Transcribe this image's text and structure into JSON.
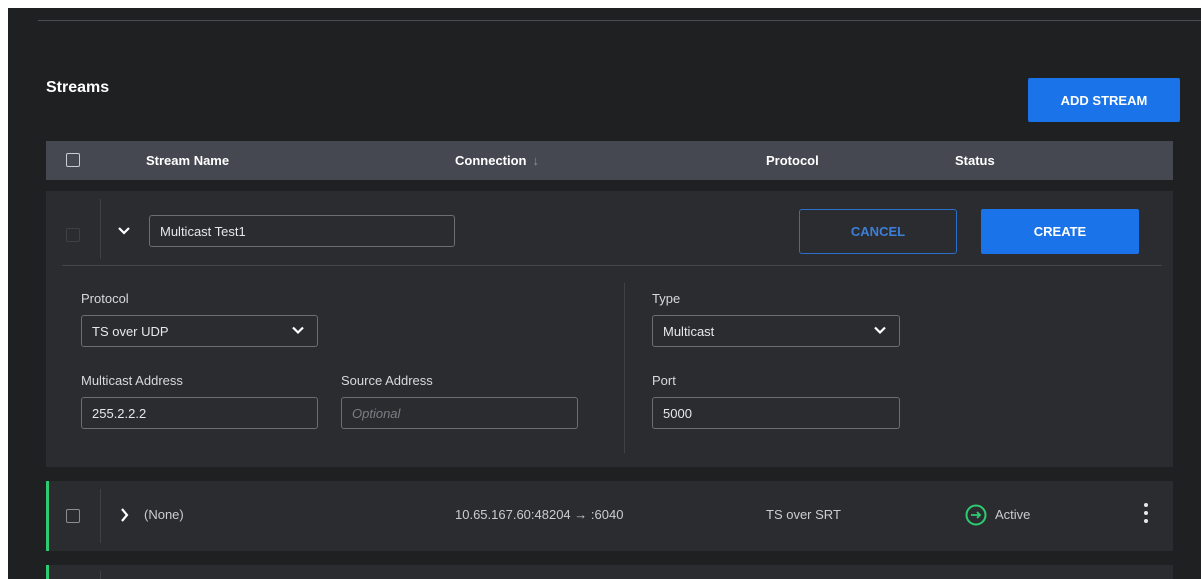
{
  "section": {
    "title": "Streams"
  },
  "actions": {
    "add_stream_label": "ADD STREAM"
  },
  "table": {
    "columns": {
      "stream_name": "Stream Name",
      "connection": "Connection",
      "connection_sort_glyph": "↓",
      "protocol": "Protocol",
      "status": "Status"
    }
  },
  "editor": {
    "stream_name_value": "Multicast Test1",
    "cancel_label": "CANCEL",
    "create_label": "CREATE",
    "protocol": {
      "label": "Protocol",
      "value": "TS over UDP"
    },
    "type": {
      "label": "Type",
      "value": "Multicast"
    },
    "multicast_address": {
      "label": "Multicast Address",
      "value": "255.2.2.2"
    },
    "source_address": {
      "label": "Source Address",
      "placeholder": "Optional"
    },
    "port": {
      "label": "Port",
      "value": "5000"
    }
  },
  "rows": [
    {
      "name": "(None)",
      "connection": "10.65.167.60:48204 → :6040",
      "protocol": "TS over SRT",
      "status": "Active",
      "accent_color": "#2ecc71"
    }
  ],
  "colors": {
    "accent": "#1a73e8",
    "active": "#2ecc71",
    "background": "#1f2022"
  }
}
